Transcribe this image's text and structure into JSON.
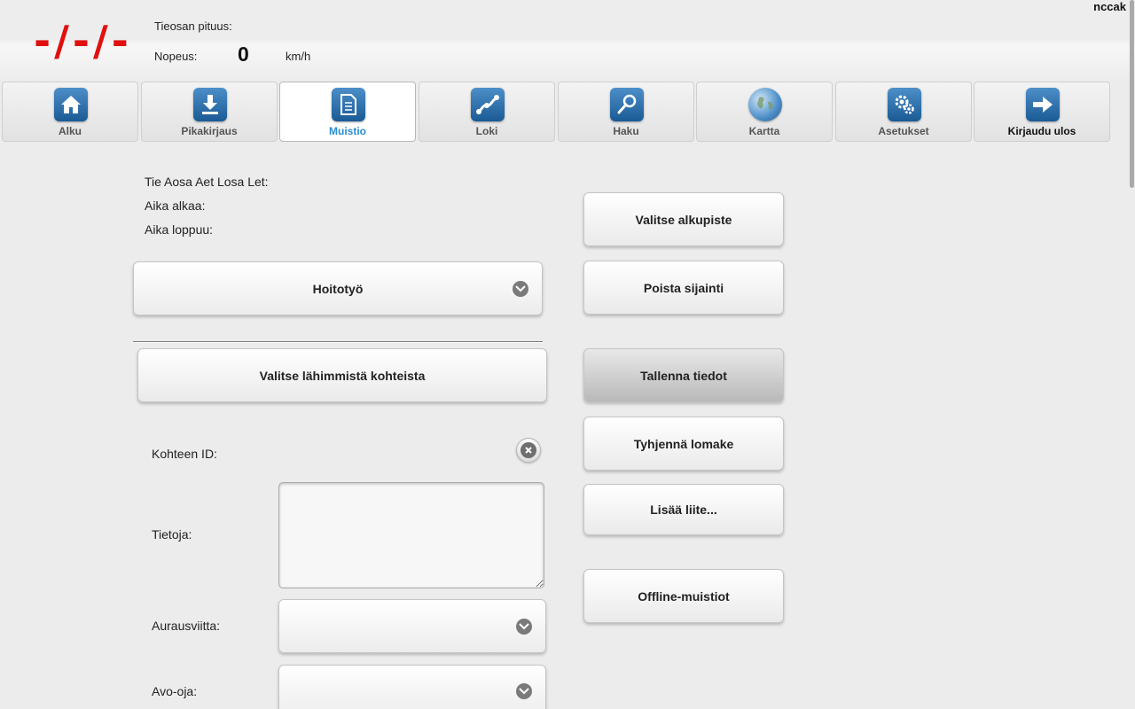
{
  "header": {
    "road_code": "-/-/-",
    "section_length_label": "Tieosan pituus:",
    "speed_label": "Nopeus:",
    "speed_value": "0",
    "speed_unit": "km/h",
    "username": "nccak"
  },
  "tabs": [
    {
      "label": "Alku",
      "icon": "home-icon"
    },
    {
      "label": "Pikakirjaus",
      "icon": "download-icon"
    },
    {
      "label": "Muistio",
      "icon": "document-icon",
      "active": true
    },
    {
      "label": "Loki",
      "icon": "chart-line-icon"
    },
    {
      "label": "Haku",
      "icon": "search-icon"
    },
    {
      "label": "Kartta",
      "icon": "globe-icon"
    },
    {
      "label": "Asetukset",
      "icon": "gears-icon"
    },
    {
      "label": "Kirjaudu ulos",
      "icon": "arrow-right-icon"
    }
  ],
  "form": {
    "road_address_label": "Tie Aosa Aet Losa Let:",
    "time_start_label": "Aika alkaa:",
    "time_end_label": "Aika loppuu:",
    "work_type_value": "Hoitotyö",
    "nearest_button": "Valitse lähimmistä kohteista",
    "target_id_label": "Kohteen ID:",
    "info_label": "Tietoja:",
    "plow_marker_label": "Aurausviitta:",
    "open_ditch_label": "Avo-oja:"
  },
  "actions": {
    "select_start": "Valitse alkupiste",
    "remove_location": "Poista sijainti",
    "save": "Tallenna tiedot",
    "clear_form": "Tyhjennä lomake",
    "add_attachment": "Lisää liite...",
    "offline_notes": "Offline-muistiot"
  },
  "colors": {
    "road_code": "#e01010",
    "active_tab_label": "#2a8ed0",
    "icon_blue": "#1f6aa9"
  }
}
